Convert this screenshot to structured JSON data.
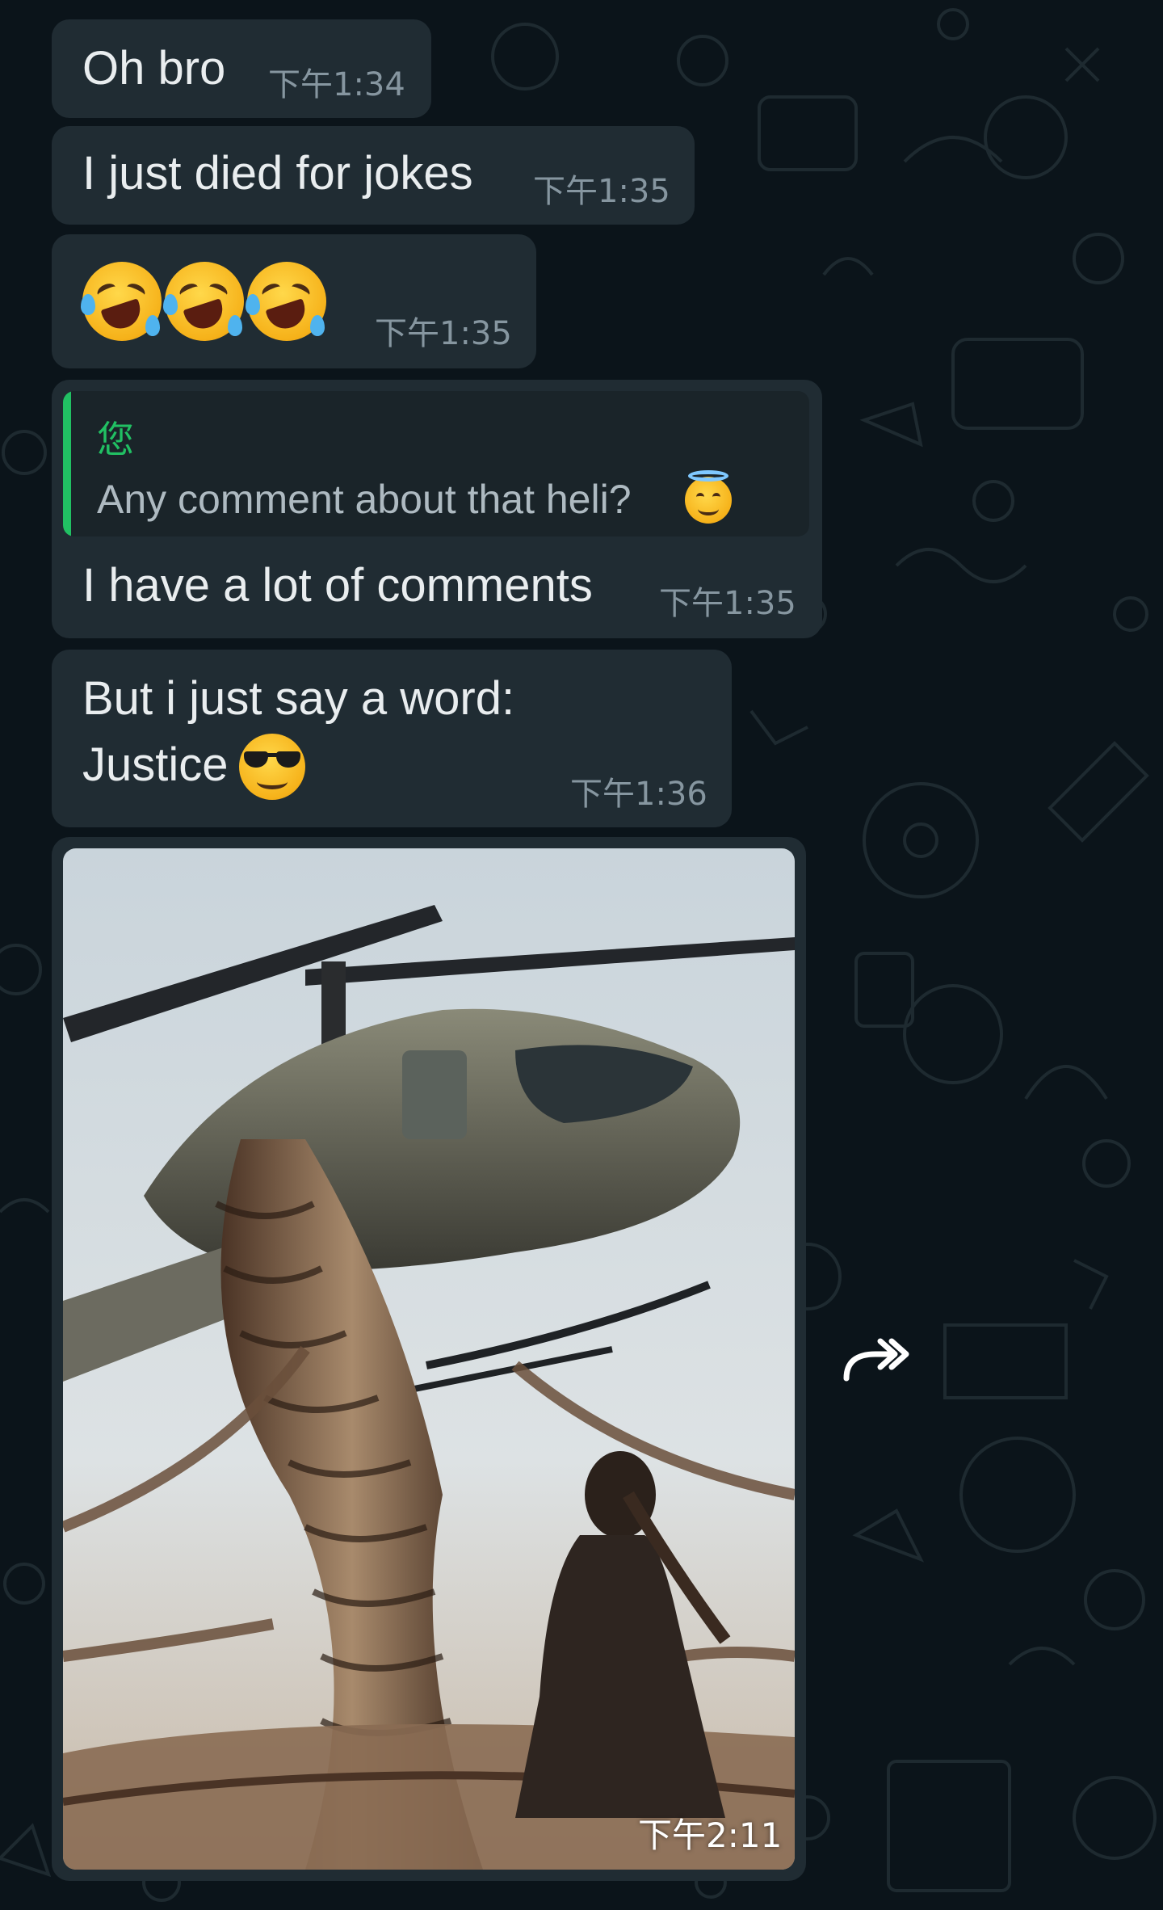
{
  "messages": [
    {
      "text": "Oh bro",
      "time": "下午1:34"
    },
    {
      "text": "I just died for jokes",
      "time": "下午1:35"
    },
    {
      "emoji": [
        "rolling-on-floor-laughing-emoji",
        "rolling-on-floor-laughing-emoji",
        "rolling-on-floor-laughing-emoji"
      ],
      "time": "下午1:35"
    },
    {
      "reply": {
        "author": "您",
        "text": "Any comment about that heli?",
        "emoji": "smiling-face-with-halo-emoji"
      },
      "text": "I have a lot of comments",
      "time": "下午1:35"
    },
    {
      "lines": [
        "But i just say a word:",
        "Justice"
      ],
      "emoji": "smiling-face-with-sunglasses-emoji",
      "time": "下午1:36"
    },
    {
      "image": "helicopter-lifted-by-braided-hair-photo",
      "time": "下午2:11"
    }
  ],
  "icons": {
    "forward": "forward-arrow-icon"
  },
  "colors": {
    "chat_background": "#0b141a",
    "bubble": "#202c33",
    "text": "#e9edef",
    "timestamp": "#8696a0",
    "reply_accent": "#21c063"
  }
}
